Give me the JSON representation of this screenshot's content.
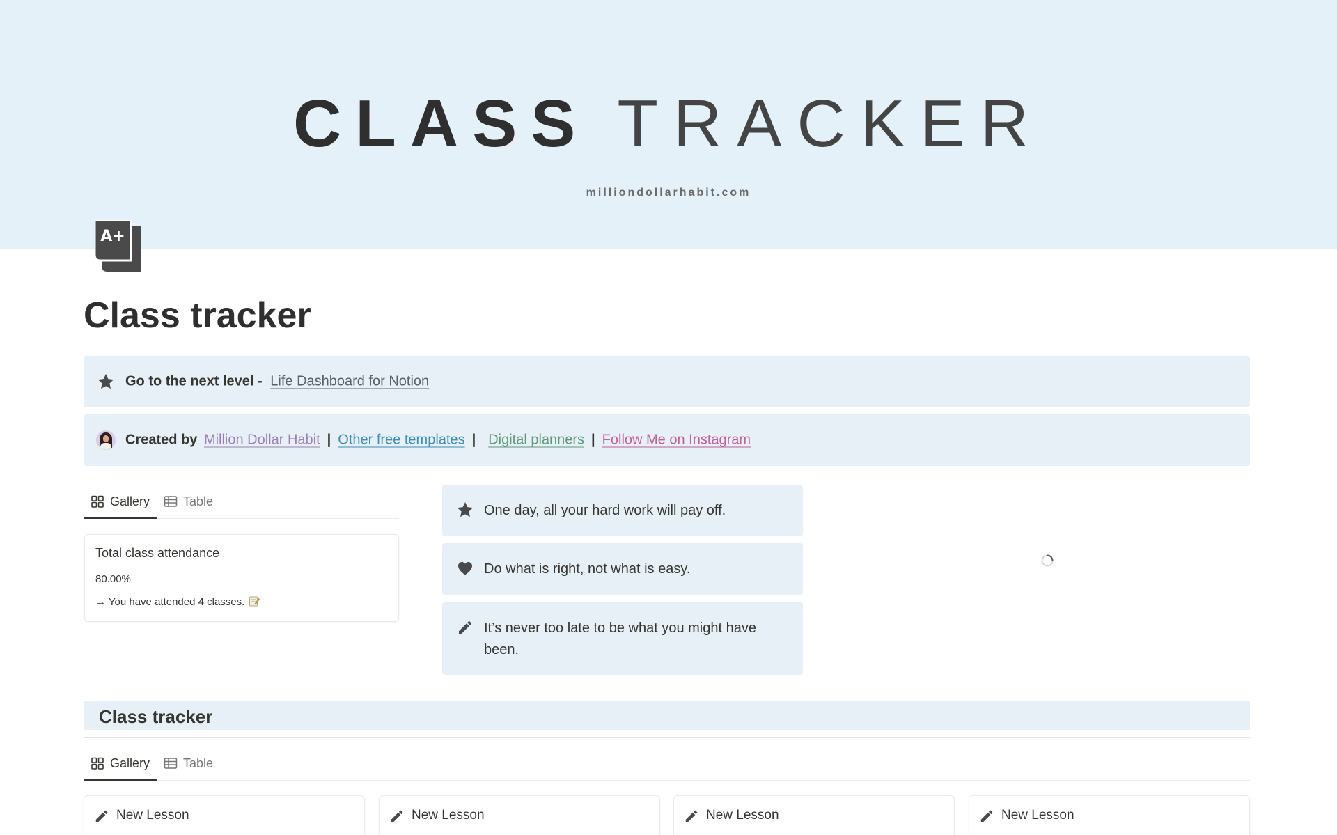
{
  "cover": {
    "title_bold": "CLASS",
    "title_thin": "TRACKER",
    "url": "milliondollarhabit.com"
  },
  "page": {
    "icon": "a-plus-stack-icon",
    "title": "Class tracker"
  },
  "callouts": {
    "next_level": {
      "icon": "star-icon",
      "label": "Go to the next level -",
      "link": "Life Dashboard for Notion"
    },
    "credits": {
      "icon": "avatar",
      "label": "Created by",
      "author_link": "Million Dollar Habit",
      "separator": "|",
      "links": [
        "Other free templates",
        "Digital planners",
        "Follow Me on Instagram"
      ]
    }
  },
  "attendance_view": {
    "tabs": [
      {
        "label": "Gallery",
        "icon": "gallery-icon",
        "active": true
      },
      {
        "label": "Table",
        "icon": "table-icon",
        "active": false
      }
    ],
    "card": {
      "title": "Total class attendance",
      "percent": "80.00%",
      "note": "→ You have attended 4 classes."
    }
  },
  "quotes": [
    {
      "icon": "star-icon",
      "text": "One day, all your hard work will pay off."
    },
    {
      "icon": "heart-icon",
      "text": "Do what is right, not what is easy."
    },
    {
      "icon": "pencil-icon",
      "text": "It’s never too late to be what you might have been."
    }
  ],
  "class_section": {
    "heading": "Class tracker",
    "tabs": [
      {
        "label": "Gallery",
        "icon": "gallery-icon",
        "active": true
      },
      {
        "label": "Table",
        "icon": "table-icon",
        "active": false
      }
    ],
    "cards": [
      {
        "icon": "pencil-icon",
        "title": "New Lesson"
      },
      {
        "icon": "pencil-icon",
        "title": "New Lesson"
      },
      {
        "icon": "pencil-icon",
        "title": "New Lesson"
      },
      {
        "icon": "pencil-icon",
        "title": "New Lesson"
      }
    ]
  },
  "colors": {
    "cover_bg": "#e5f1f8",
    "callout_bg": "#e6f0f6",
    "text": "#37352f",
    "link_purple": "#9a7fb8",
    "link_blue": "#3f8dbb",
    "link_green": "#5f9a78",
    "link_pink": "#c05f98"
  }
}
